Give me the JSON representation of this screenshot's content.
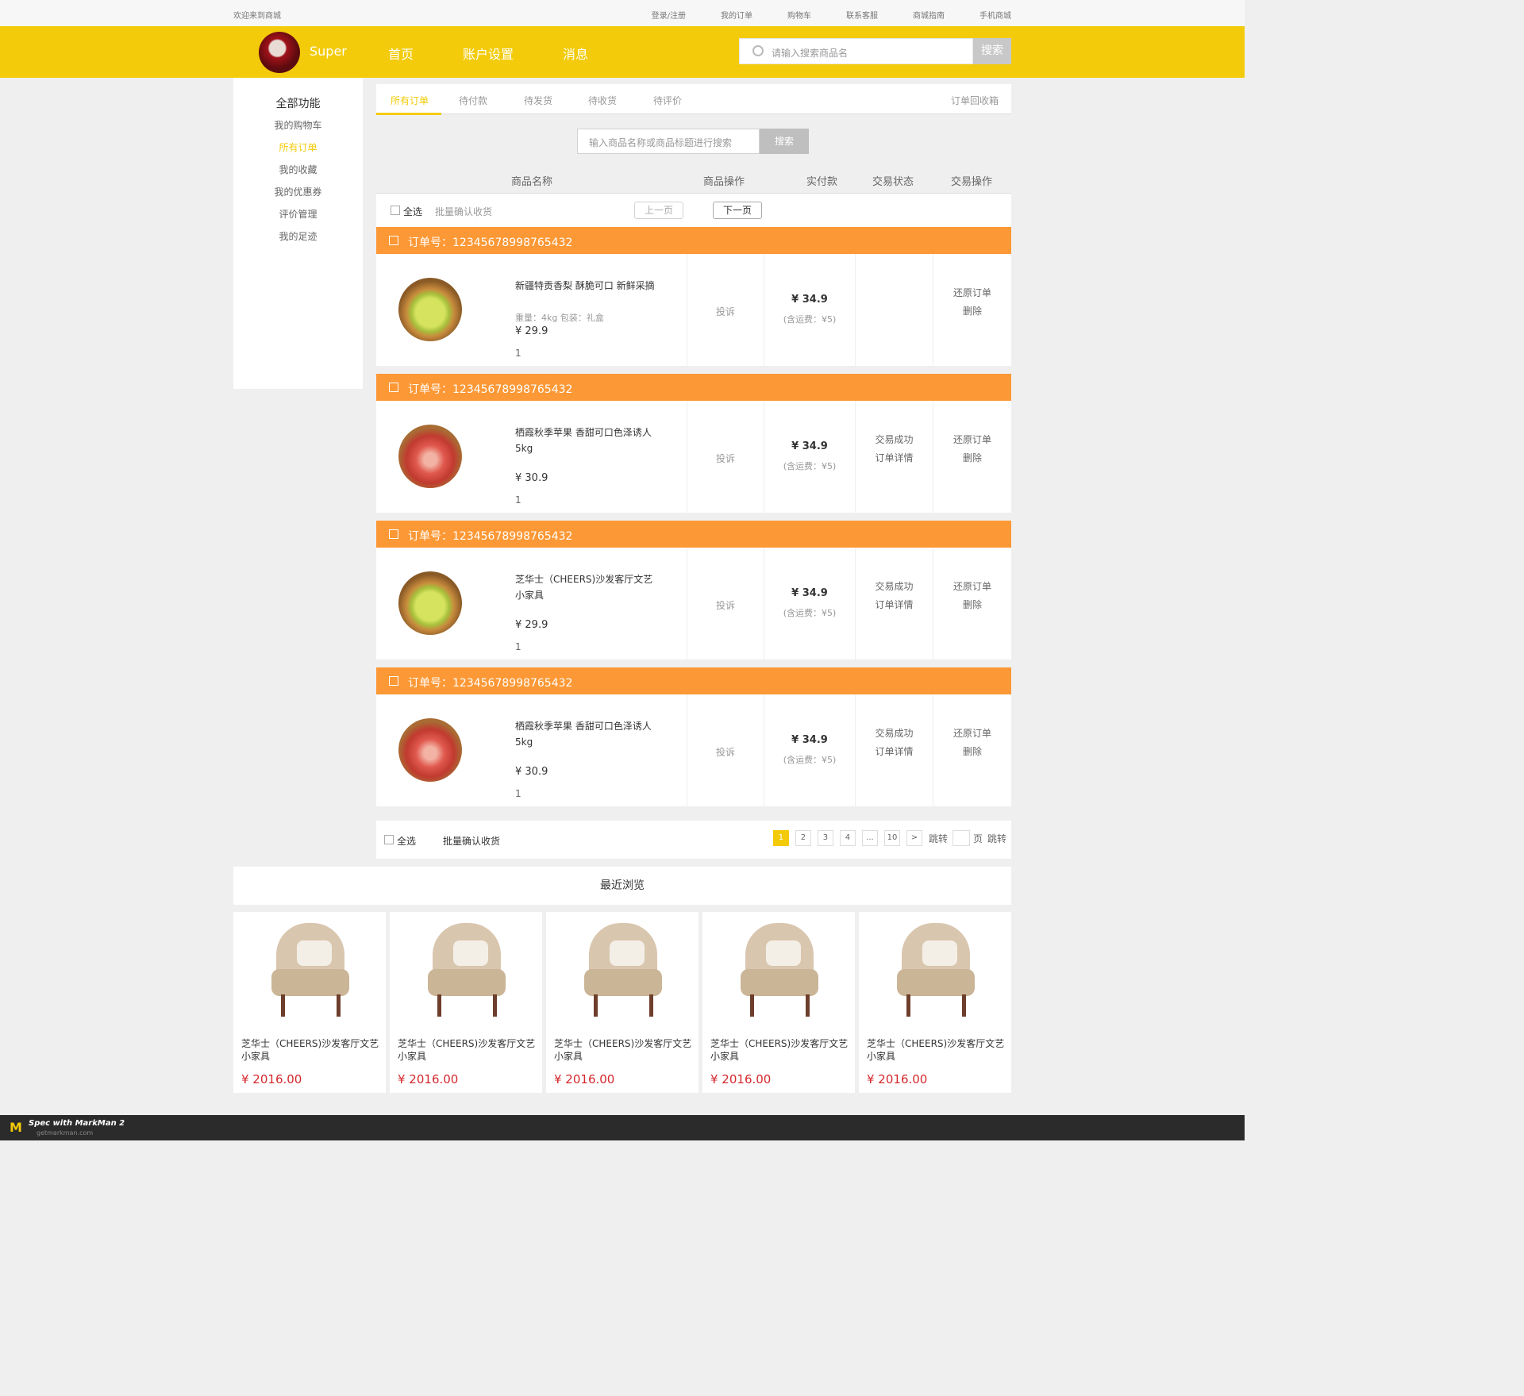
{
  "topbar": {
    "welcome": "欢迎来到商城",
    "links": [
      "登录/注册",
      "我的订单",
      "购物车",
      "联系客服",
      "商城指南",
      "手机商城"
    ]
  },
  "header": {
    "brand": "Super",
    "nav": [
      "首页",
      "账户设置",
      "消息"
    ],
    "search_placeholder": "请输入搜索商品名",
    "search_button": "搜索"
  },
  "sidebar": {
    "title": "全部功能",
    "items": [
      "我的购物车",
      "所有订单",
      "我的收藏",
      "我的优惠券",
      "评价管理",
      "我的足迹"
    ],
    "active_index": 1
  },
  "tabs": {
    "items": [
      "所有订单",
      "待付款",
      "待发货",
      "待收货",
      "待评价"
    ],
    "recycle": "订单回收箱"
  },
  "order_search": {
    "placeholder": "输入商品名称或商品标题进行搜索",
    "button": "搜索"
  },
  "table_head": [
    "商品名称",
    "商品操作",
    "实付款",
    "交易状态",
    "交易操作"
  ],
  "toolbar": {
    "select_all": "全选",
    "batch_confirm": "批量确认收货",
    "prev": "上一页",
    "next": "下一页"
  },
  "orders": [
    {
      "order_no": "订单号：12345678998765432",
      "product": "新疆特贡香梨 酥脆可口 新鲜采摘",
      "spec": "重量：4kg   包装：礼盒",
      "price": "¥ 29.9",
      "qty": "1",
      "complain": "投诉",
      "paid": "¥ 34.9",
      "shipping": "(含运费：¥5)",
      "status": [],
      "actions": [
        "还原订单",
        "删除"
      ],
      "image": "pear"
    },
    {
      "order_no": "订单号：12345678998765432",
      "product": "栖霞秋季苹果  香甜可口色泽诱人5kg",
      "spec": "",
      "price": "¥ 30.9",
      "qty": "1",
      "complain": "投诉",
      "paid": "¥ 34.9",
      "shipping": "(含运费：¥5)",
      "status": [
        "交易成功",
        "订单详情"
      ],
      "actions": [
        "还原订单",
        "删除"
      ],
      "image": "apple"
    },
    {
      "order_no": "订单号：12345678998765432",
      "product": "芝华士（CHEERS)沙发客厅文艺小家具",
      "spec": "",
      "price": "¥ 29.9",
      "qty": "1",
      "complain": "投诉",
      "paid": "¥ 34.9",
      "shipping": "(含运费：¥5)",
      "status": [
        "交易成功",
        "订单详情"
      ],
      "actions": [
        "还原订单",
        "删除"
      ],
      "image": "pear"
    },
    {
      "order_no": "订单号：12345678998765432",
      "product": "栖霞秋季苹果  香甜可口色泽诱人5kg",
      "spec": "",
      "price": "¥ 30.9",
      "qty": "1",
      "complain": "投诉",
      "paid": "¥ 34.9",
      "shipping": "(含运费：¥5)",
      "status": [
        "交易成功",
        "订单详情"
      ],
      "actions": [
        "还原订单",
        "删除"
      ],
      "image": "apple"
    }
  ],
  "bottom_bar": {
    "select_all": "全选",
    "batch_confirm": "批量确认收货",
    "pages": [
      "1",
      "2",
      "3",
      "4",
      "...",
      "10",
      ">"
    ],
    "jump": "跳转",
    "page_unit": "页",
    "jump_button": "跳转"
  },
  "recent": {
    "title": "最近浏览",
    "items": [
      {
        "name": "芝华士（CHEERS)沙发客厅文艺小家具",
        "price": "¥ 2016.00"
      },
      {
        "name": "芝华士（CHEERS)沙发客厅文艺小家具",
        "price": "¥ 2016.00"
      },
      {
        "name": "芝华士（CHEERS)沙发客厅文艺小家具",
        "price": "¥ 2016.00"
      },
      {
        "name": "芝华士（CHEERS)沙发客厅文艺小家具",
        "price": "¥ 2016.00"
      },
      {
        "name": "芝华士（CHEERS)沙发客厅文艺小家具",
        "price": "¥ 2016.00"
      }
    ]
  },
  "footer": {
    "spec": "Spec with MarkMan 2",
    "site": "getmarkman.com"
  },
  "colors": {
    "brand_yellow": "#f3cb0a",
    "order_orange": "#fc9835",
    "price_red": "#d4282d"
  }
}
